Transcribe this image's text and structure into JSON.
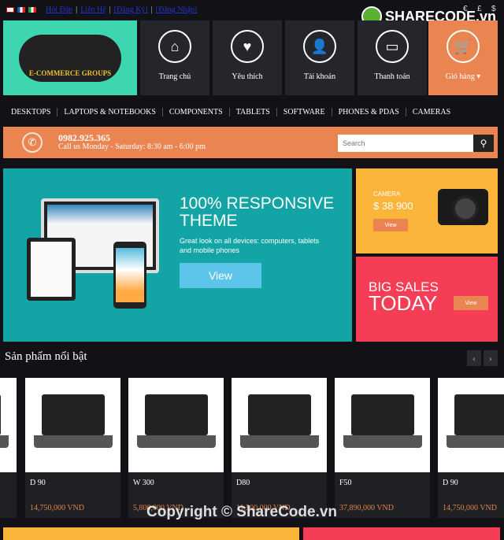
{
  "topbar": {
    "links": [
      "Hỏi Đáp",
      "Liên Hệ",
      "[Đăng Ký]",
      "[Đăng Nhập]"
    ],
    "currency": [
      "€",
      "£",
      "$"
    ]
  },
  "watermark": {
    "logo": "SHARECODE.vn",
    "copyright": "Copyright © ShareCode.vn"
  },
  "logo": {
    "text": "E-COMMERCE GROUPS"
  },
  "nav": [
    {
      "label": "Trang chủ",
      "icon": "home-icon"
    },
    {
      "label": "Yêu thích",
      "icon": "heart-icon"
    },
    {
      "label": "Tài khoản",
      "icon": "user-icon"
    },
    {
      "label": "Thanh toán",
      "icon": "card-icon"
    },
    {
      "label": "Giỏ hàng ▾",
      "icon": "cart-icon"
    }
  ],
  "menu": [
    "DESKTOPS",
    "LAPTOPS & NOTEBOOKS",
    "COMPONENTS",
    "TABLETS",
    "SOFTWARE",
    "PHONES & PDAS",
    "CAMERAS"
  ],
  "contact": {
    "phone": "0982.925.365",
    "hours": "Call us Monday - Saturday: 8:30 am - 6:00 pm"
  },
  "search": {
    "placeholder": "Search"
  },
  "hero": {
    "title": "100% RESPONSIVE THEME",
    "desc": "Great look on all devices: computers, tablets and mobile phones",
    "button": "View"
  },
  "camera_promo": {
    "label": "CAMERA",
    "price": "$ 38 900",
    "button": "View"
  },
  "sales_promo": {
    "line1": "BIG SALES",
    "line2": "TODAY",
    "button": "View"
  },
  "featured": {
    "title": "Sản phẩm nổi bật",
    "prev": "‹",
    "next": "›",
    "products": [
      {
        "name": "D 90",
        "price": "14,750,000 VND"
      },
      {
        "name": "W 300",
        "price": "5,800,000 VND"
      },
      {
        "name": "D80",
        "price": "11,500,000 VND"
      },
      {
        "name": "F50",
        "price": "37,890,000 VND"
      },
      {
        "name": "D 90",
        "price": "14,750,000 VND"
      }
    ]
  },
  "colors": {
    "orange": "#ea8552",
    "teal": "#13a5a6",
    "mint": "#3ed6b0",
    "yellow": "#fbb53a",
    "red": "#f53d55",
    "dark": "#121216"
  }
}
